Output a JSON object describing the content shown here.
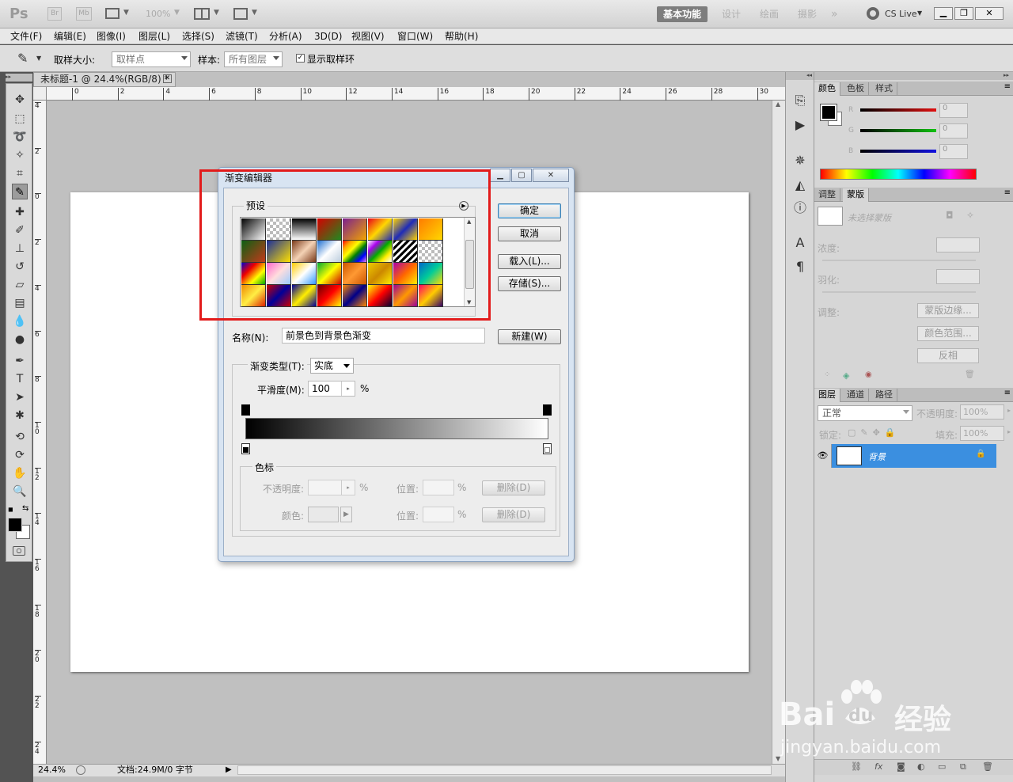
{
  "app": {
    "logo": "Ps",
    "bridge": "Br",
    "minibridge": "Mb",
    "zoom": "100%",
    "workspaces": [
      "基本功能",
      "设计",
      "绘画",
      "摄影"
    ],
    "more": "»",
    "cslive": "CS Live"
  },
  "menu": [
    "文件(F)",
    "编辑(E)",
    "图像(I)",
    "图层(L)",
    "选择(S)",
    "滤镜(T)",
    "分析(A)",
    "3D(D)",
    "视图(V)",
    "窗口(W)",
    "帮助(H)"
  ],
  "options": {
    "sample_size_label": "取样大小:",
    "sample_size_value": "取样点",
    "sample_label": "样本:",
    "sample_value": "所有图层",
    "show_ring_label": "显示取样环"
  },
  "document": {
    "tab_title": "未标题-1 @ 24.4%(RGB/8) *",
    "ruler_h": [
      "0",
      "2",
      "4",
      "6",
      "8",
      "10",
      "12",
      "14",
      "16",
      "18",
      "20",
      "22",
      "24",
      "26",
      "28",
      "30"
    ],
    "ruler_v": [
      "4",
      "2",
      "0",
      "2",
      "4",
      "6",
      "8",
      "1 0",
      "1 2",
      "1 4",
      "1 6",
      "1 8",
      "2 0",
      "2 2",
      "2 4"
    ],
    "zoom": "24.4%",
    "doc_info": "文档:24.9M/0 字节"
  },
  "dialog": {
    "title": "渐变编辑器",
    "presets_label": "预设",
    "ok": "确定",
    "cancel": "取消",
    "load": "载入(L)...",
    "save": "存储(S)...",
    "name_label": "名称(N):",
    "name_value": "前景色到背景色渐变",
    "new_button": "新建(W)",
    "type_label": "渐变类型(T):",
    "type_value": "实底",
    "smooth_label": "平滑度(M):",
    "smooth_value": "100",
    "percent": "%",
    "stops_label": "色标",
    "opacity_label": "不透明度:",
    "color_label": "颜色:",
    "location_label": "位置:",
    "delete_button": "删除(D)",
    "presets": [
      "linear-gradient(135deg,#000,#fff)",
      "repeating-conic-gradient(#bbb 0 25%,#fff 0 50%) 0 0/8px 8px",
      "linear-gradient(#000,#fff)",
      "linear-gradient(135deg,#d40000,#1f8a1f)",
      "linear-gradient(135deg,#7a1f8f,#f2a400)",
      "linear-gradient(135deg,#e8001c,#ffd700,#1e2bb8)",
      "linear-gradient(135deg,#ffd400,#1e2bb8,#ffd400)",
      "linear-gradient(135deg,#ff7b00,#ffd700)",
      "linear-gradient(135deg,#0b5f13,#c43a1b)",
      "linear-gradient(135deg,#1a2d9a,#ffe100)",
      "linear-gradient(135deg,#7a3a1a,#f4d2b5,#7a3a1a)",
      "linear-gradient(135deg,#1e6fd1,#fff,#bcd)",
      "linear-gradient(135deg,red,orange,yellow,green,blue,violet)",
      "linear-gradient(135deg,#fff,#a0e,#0a0,#fe0,#fff)",
      "repeating-linear-gradient(135deg,#000 0 3px,#fff 3px 6px)",
      "repeating-conic-gradient(#bbb 0 25%,#fff 0 50%) 0 0/8px 8px",
      "linear-gradient(135deg,#00c,#e00,#ff0,#0a0)",
      "linear-gradient(135deg,#f6c,#fdd,#9cf)",
      "linear-gradient(135deg,#fc0,#fff,#39f)",
      "linear-gradient(135deg,#0a3,#ff0,#c00)",
      "linear-gradient(135deg,#c50,#f93,#c50)",
      "linear-gradient(135deg,#ec0,#c80,#fe0)",
      "linear-gradient(135deg,#a0a,#f60,#fe0)",
      "linear-gradient(135deg,#06c,#0c9,#fd0)",
      "linear-gradient(135deg,#e80,#fe4,#d20)",
      "linear-gradient(135deg,#c00,#009,#c00)",
      "linear-gradient(135deg,#009,#fe0,#009)",
      "linear-gradient(135deg,#600,#f00,#ff0)",
      "linear-gradient(135deg,#f80,#008,#f80)",
      "linear-gradient(135deg,#ff0,#f00,#003)",
      "linear-gradient(135deg,#909,#f90,#909)",
      "linear-gradient(135deg,#f06,#fc0,#306)"
    ]
  },
  "color_panel": {
    "tabs": [
      "颜色",
      "色板",
      "样式"
    ],
    "channels": [
      {
        "label": "R",
        "value": "0",
        "color": "#e01010"
      },
      {
        "label": "G",
        "value": "0",
        "color": "#10c010"
      },
      {
        "label": "B",
        "value": "0",
        "color": "#1010e0"
      }
    ]
  },
  "masks_panel": {
    "tabs": [
      "调整",
      "蒙版"
    ],
    "title": "未选择蒙版",
    "density": "浓度:",
    "feather": "羽化:",
    "adjust": "调整:",
    "buttons": [
      "蒙版边缘...",
      "颜色范围...",
      "反相"
    ]
  },
  "layers_panel": {
    "tabs": [
      "图层",
      "通道",
      "路径"
    ],
    "blend_mode": "正常",
    "opacity_label": "不透明度:",
    "opacity_value": "100%",
    "lock_label": "锁定:",
    "fill_label": "填充:",
    "fill_value": "100%",
    "layer_name": "背景"
  },
  "watermark": {
    "brand_latin_1": "Bai",
    "brand_latin_2": "du",
    "brand_cn": "经验",
    "url": "jingyan.baidu.com"
  }
}
